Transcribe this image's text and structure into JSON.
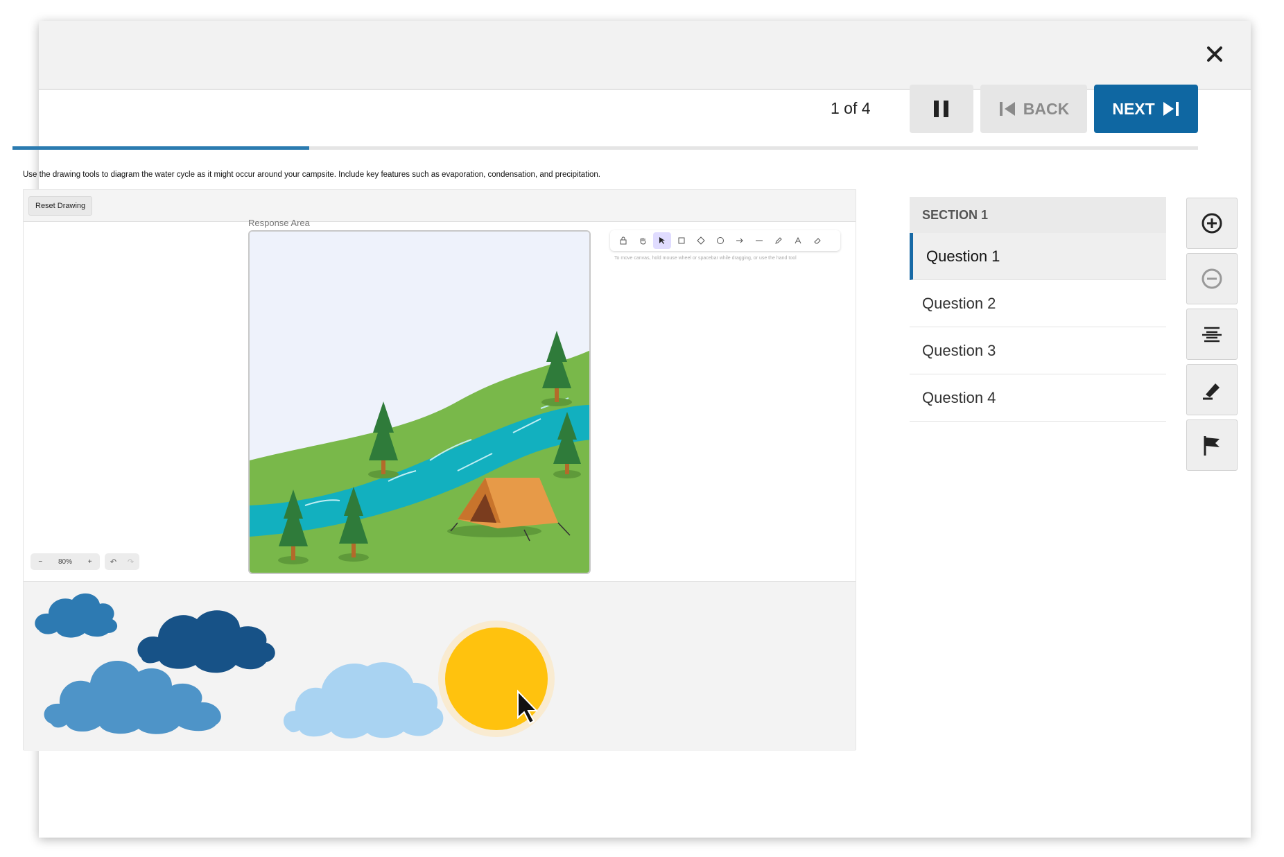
{
  "header": {
    "close_icon": "close-icon"
  },
  "nav": {
    "counter": "1 of 4",
    "pause_icon": "pause-icon",
    "back_label": "BACK",
    "next_label": "NEXT",
    "progress": 0.25,
    "accent": "#0f67a2"
  },
  "question": {
    "prompt": "Use the drawing tools to diagram the water cycle as it might occur around your campsite. Include key features such as evaporation, condensation, and precipitation."
  },
  "drawing": {
    "reset_label": "Reset Drawing",
    "response_label": "Response Area",
    "hint": "To move canvas, hold mouse wheel or spacebar while dragging, or use the hand tool",
    "zoom": "80%",
    "tools": [
      "lock-icon",
      "hand-icon",
      "select-icon",
      "rectangle-icon",
      "diamond-icon",
      "ellipse-icon",
      "arrow-icon",
      "line-icon",
      "pencil-icon",
      "text-icon",
      "eraser-icon"
    ],
    "active_tool": "select-icon"
  },
  "library": {
    "stickers": [
      "cloud-small-sticker",
      "cloud-dark-sticker",
      "cloud-medium-sticker",
      "cloud-light-sticker",
      "sun-sticker"
    ]
  },
  "sidebar": {
    "section": "SECTION 1",
    "questions": [
      "Question 1",
      "Question 2",
      "Question 3",
      "Question 4"
    ],
    "active": "Question 1"
  },
  "tools": [
    "zoom-in-icon",
    "zoom-out-icon",
    "line-reader-icon",
    "highlighter-icon",
    "flag-icon"
  ]
}
